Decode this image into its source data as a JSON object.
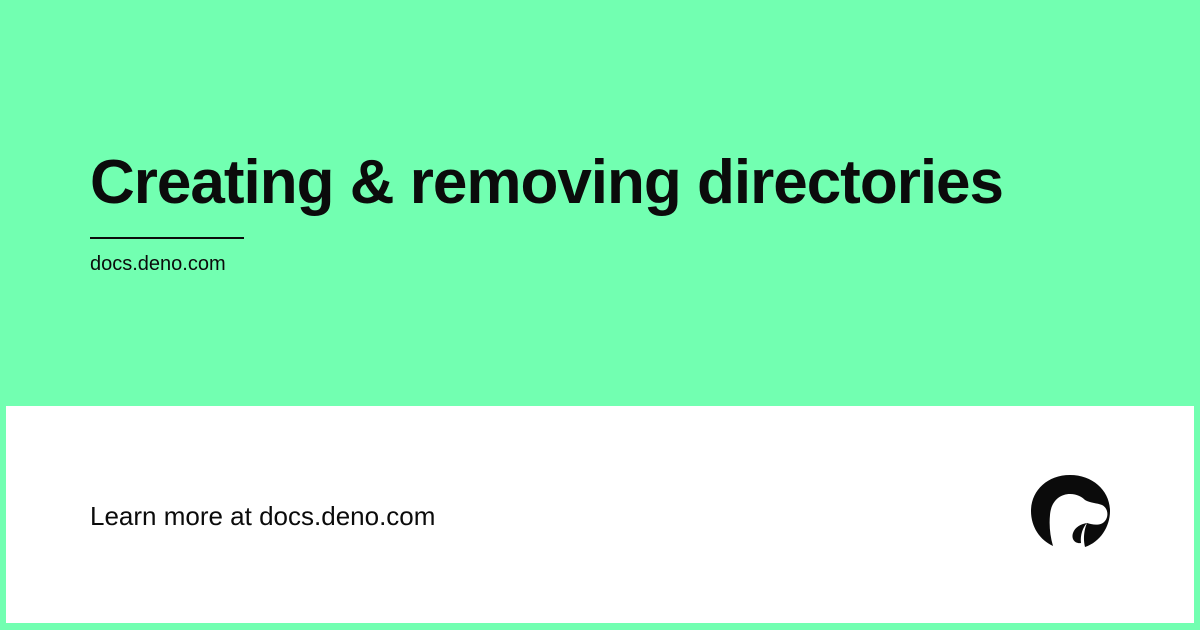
{
  "header": {
    "title": "Creating & removing directories",
    "site": "docs.deno.com"
  },
  "footer": {
    "cta": "Learn more at docs.deno.com",
    "logo_icon": "deno-dinosaur-icon"
  },
  "colors": {
    "background": "#72ffb1",
    "card": "#ffffff",
    "text": "#0b0b0b"
  }
}
